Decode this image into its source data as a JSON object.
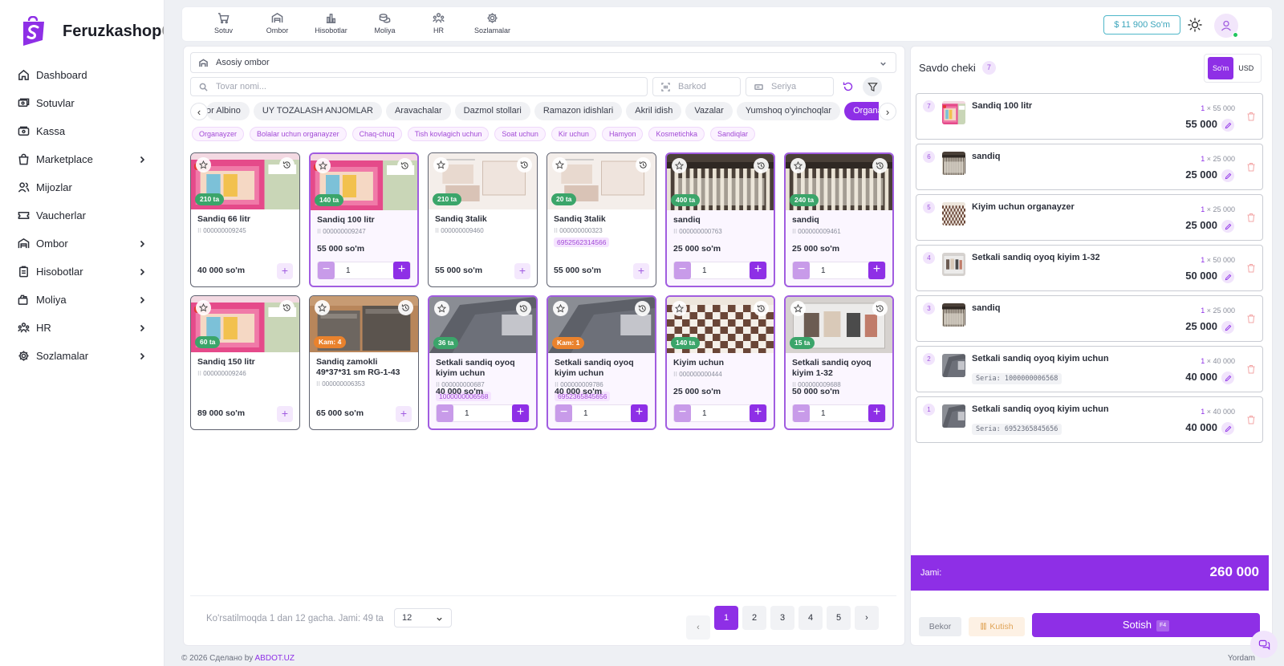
{
  "brand": {
    "name": "Feruzkashop",
    "name_rest": "C"
  },
  "sidebar": {
    "items": [
      {
        "label": "Dashboard",
        "icon": "home-icon",
        "has_chevron": false
      },
      {
        "label": "Sotuvlar",
        "icon": "cash-icon",
        "has_chevron": false
      },
      {
        "label": "Kassa",
        "icon": "cash-register-icon",
        "has_chevron": false
      },
      {
        "label": "Marketplace",
        "icon": "shopping-bag-icon",
        "has_chevron": true
      },
      {
        "label": "Mijozlar",
        "icon": "users-icon",
        "has_chevron": false
      },
      {
        "label": "Vaucherlar",
        "icon": "ticket-icon",
        "has_chevron": false
      },
      {
        "label": "Ombor",
        "icon": "warehouse-icon",
        "has_chevron": true
      },
      {
        "label": "Hisobotlar",
        "icon": "clipboard-icon",
        "has_chevron": true
      },
      {
        "label": "Moliya",
        "icon": "wallet-icon",
        "has_chevron": true
      },
      {
        "label": "HR",
        "icon": "team-icon",
        "has_chevron": true
      },
      {
        "label": "Sozlamalar",
        "icon": "gear-icon",
        "has_chevron": true
      }
    ]
  },
  "topnav": {
    "items": [
      {
        "label": "Sotuv",
        "icon": "cart-icon"
      },
      {
        "label": "Ombor",
        "icon": "warehouse-icon"
      },
      {
        "label": "Hisobotlar",
        "icon": "chart-icon"
      },
      {
        "label": "Moliya",
        "icon": "coins-icon"
      },
      {
        "label": "HR",
        "icon": "team-icon"
      },
      {
        "label": "Sozlamalar",
        "icon": "gear-icon"
      }
    ],
    "balance": "$ 11 900 So'm"
  },
  "filters": {
    "warehouse": "Asosiy ombor",
    "search_placeholder": "Tovar nomi...",
    "barcode_placeholder": "Barkod",
    "serial_placeholder": "Seriya"
  },
  "categories": [
    "or Albino",
    "UY TOZALASH ANJOMLAR",
    "Aravachalar",
    "Dazmol stollari",
    "Ramazon idishlari",
    "Akril idish",
    "Vazalar",
    "Yumshoq o'yinchoqlar",
    "Organayzerlar"
  ],
  "active_category": "Organayzerlar",
  "subcategories": [
    "Organayzer",
    "Bolalar uchun organayzer",
    "Chaq-chuq",
    "Tish kovlagich uchun",
    "Soat uchun",
    "Kir uchun",
    "Hamyon",
    "Kosmetichka",
    "Sandiqlar"
  ],
  "products": [
    {
      "name": "Sandiq 66 litr",
      "code": "000000009245",
      "stock": "210 ta",
      "stock_color": "green",
      "price": "40 000 so'm",
      "serial": "",
      "selected": false,
      "qty": "",
      "img": "pink"
    },
    {
      "name": "Sandiq 100 litr",
      "code": "000000009247",
      "stock": "140 ta",
      "stock_color": "green",
      "price": "55 000 so'm",
      "serial": "",
      "selected": true,
      "qty": "1",
      "img": "pink"
    },
    {
      "name": "Sandiq 3talik",
      "code": "000000009460",
      "stock": "210 ta",
      "stock_color": "green",
      "price": "55 000 so'm",
      "serial": "",
      "selected": false,
      "qty": "",
      "img": "beige"
    },
    {
      "name": "Sandiq 3talik",
      "code": "000000000323",
      "stock": "20 ta",
      "stock_color": "green",
      "price": "55 000 so'm",
      "serial": "6952562314566",
      "selected": false,
      "qty": "",
      "img": "beige"
    },
    {
      "name": "sandiq",
      "code": "000000000763",
      "stock": "400 ta",
      "stock_color": "green",
      "price": "25 000 so'm",
      "serial": "",
      "selected": true,
      "qty": "1",
      "img": "stripe"
    },
    {
      "name": "sandiq",
      "code": "000000009461",
      "stock": "240 ta",
      "stock_color": "green",
      "price": "25 000 so'm",
      "serial": "",
      "selected": true,
      "qty": "1",
      "img": "stripe"
    },
    {
      "name": "Sandiq 150 litr",
      "code": "000000009246",
      "stock": "60 ta",
      "stock_color": "green",
      "price": "89 000 so'm",
      "serial": "",
      "selected": false,
      "qty": "",
      "img": "pink"
    },
    {
      "name": "Sandiq zamokli 49*37*31 sm RG-1-43",
      "code": "000000006353",
      "stock": "Kam: 4",
      "stock_color": "orange",
      "price": "65 000 so'm",
      "serial": "",
      "selected": false,
      "qty": "",
      "img": "brown"
    },
    {
      "name": "Setkali sandiq oyoq kiyim uchun",
      "code": "000000000687",
      "stock": "36 ta",
      "stock_color": "green",
      "price": "40 000 so'm",
      "serial": "1000000006568",
      "selected": true,
      "qty": "1",
      "img": "grey"
    },
    {
      "name": "Setkali sandiq oyoq kiyim uchun",
      "code": "000000009786",
      "stock": "Kam: 1",
      "stock_color": "orange",
      "price": "40 000 so'm",
      "serial": "6952365845656",
      "selected": true,
      "qty": "1",
      "img": "grey"
    },
    {
      "name": "Kiyim uchun organayzer",
      "code": "000000000444",
      "stock": "140 ta",
      "stock_color": "green",
      "price": "25 000 so'm",
      "serial": "",
      "selected": true,
      "qty": "1",
      "img": "check"
    },
    {
      "name": "Setkali sandiq oyoq kiyim 1-32",
      "code": "000000009688",
      "stock": "15 ta",
      "stock_color": "green",
      "price": "50 000 so'm",
      "serial": "",
      "selected": true,
      "qty": "1",
      "img": "clear"
    }
  ],
  "pagination": {
    "showing": "Ko'rsatilmoqda 1 dan 12 gacha. Jami: 49 ta",
    "per_page": "12",
    "pages": [
      "1",
      "2",
      "3",
      "4",
      "5"
    ],
    "current": "1"
  },
  "receipt": {
    "title": "Savdo cheki",
    "count": "7",
    "currencies": [
      "So'm",
      "USD"
    ],
    "active_currency": "So'm",
    "items": [
      {
        "index": "7",
        "name": "Sandiq 100 litr",
        "qty": "1",
        "unit": "× 55 000",
        "sum": "55 000",
        "seria": "",
        "img": "pink"
      },
      {
        "index": "6",
        "name": "sandiq",
        "qty": "1",
        "unit": "× 25 000",
        "sum": "25 000",
        "seria": "",
        "img": "stripe"
      },
      {
        "index": "5",
        "name": "Kiyim uchun organayzer",
        "qty": "1",
        "unit": "× 25 000",
        "sum": "25 000",
        "seria": "",
        "img": "check"
      },
      {
        "index": "4",
        "name": "Setkali sandiq oyoq kiyim 1-32",
        "qty": "1",
        "unit": "× 50 000",
        "sum": "50 000",
        "seria": "",
        "img": "clear"
      },
      {
        "index": "3",
        "name": "sandiq",
        "qty": "1",
        "unit": "× 25 000",
        "sum": "25 000",
        "seria": "",
        "img": "stripe"
      },
      {
        "index": "2",
        "name": "Setkali sandiq oyoq kiyim uchun",
        "qty": "1",
        "unit": "× 40 000",
        "sum": "40 000",
        "seria": "Seria: 1000000006568",
        "img": "grey"
      },
      {
        "index": "1",
        "name": "Setkali sandiq oyoq kiyim uchun",
        "qty": "1",
        "unit": "× 40 000",
        "sum": "40 000",
        "seria": "Seria: 6952365845656",
        "img": "grey"
      }
    ],
    "total_label": "Jami:",
    "total_value": "260 000",
    "cancel": "Bekor",
    "hold": "Kutish",
    "sell": "Sotish",
    "sell_shortcut": "F4"
  },
  "footer": {
    "copyright": "© 2026 Сделано by",
    "link": "ABDOT.UZ",
    "right": "Yordam"
  },
  "colors": {
    "accent": "#8e2fe6",
    "stock_green": "#3ba56a",
    "stock_orange": "#e9822d",
    "balance": "#3aa4bb"
  }
}
